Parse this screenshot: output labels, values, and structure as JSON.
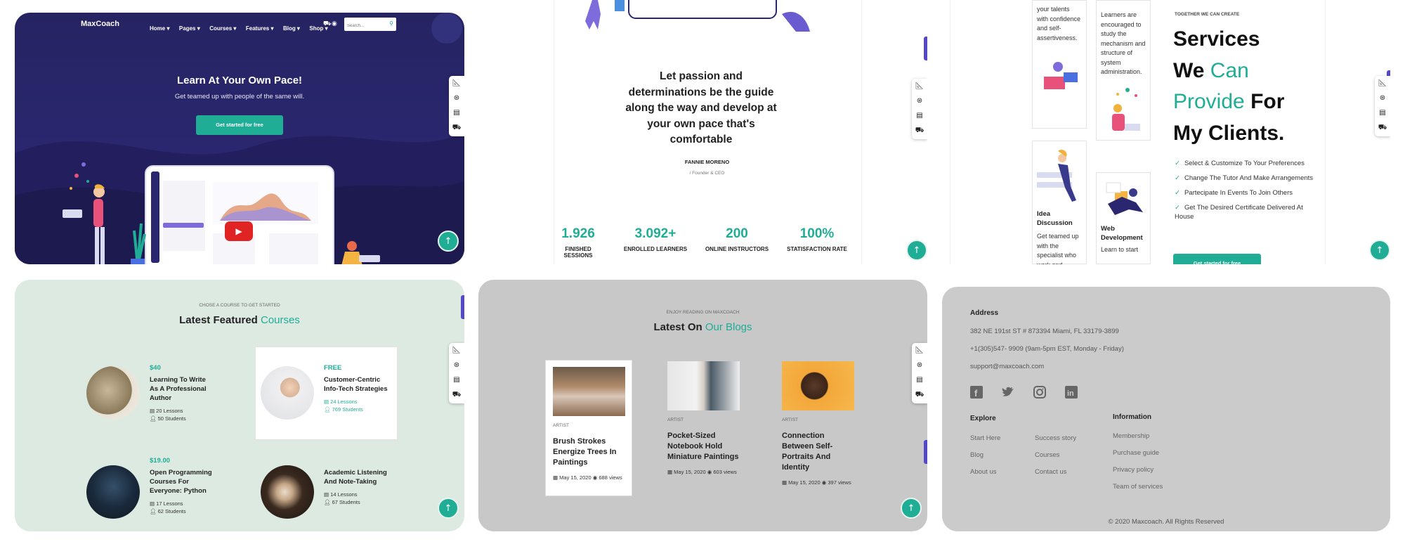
{
  "hero": {
    "logo": "MaxCoach",
    "nav": [
      "Home",
      "Pages",
      "Courses",
      "Features",
      "Blog",
      "Shop"
    ],
    "search_placeholder": "Search...",
    "title": "Learn At Your Own Pace!",
    "subtitle": "Get teamed up with people of the same will.",
    "cta": "Get started for free"
  },
  "testimonial": {
    "quote": "Let passion and determinations be the guide along the way and develop at your own pace that's comfortable",
    "name": "FANNIE MORENO",
    "role": "/ Founder & CEO",
    "stats": [
      {
        "value": "1.926",
        "label": "FINISHED SESSIONS"
      },
      {
        "value": "3.092+",
        "label": "ENROLLED LEARNERS"
      },
      {
        "value": "200",
        "label": "ONLINE INSTRUCTORS"
      },
      {
        "value": "100%",
        "label": "STATISFACTION RATE"
      }
    ]
  },
  "services": {
    "card_text_1": "your talents with confidence and self-assertiveness.",
    "card_text_2": "Learners are encouraged to study the mechanism and structure of system administration.",
    "card_title_3": "Idea Discussion",
    "card_text_3": "Get teamed up with the specialist who work and",
    "card_title_4": "Web Development",
    "card_text_4": "Learn to start",
    "eyebrow": "TOGETHER WE CAN CREATE",
    "heading_1": "Services",
    "heading_2a": "We ",
    "heading_2b": "Can",
    "heading_3a": "Provide ",
    "heading_3b": "For",
    "heading_4": "My Clients.",
    "checks": [
      "Select & Customize To Your Preferences",
      "Change The Tutor And Make Arrangements",
      "Partecipate In Events To Join Others",
      "Get The Desired Certificate Delivered At House"
    ],
    "cta": "Get started for free"
  },
  "courses": {
    "eyebrow": "CHOSE A COURSE TO GET STARTED",
    "title_a": "Latest Featured ",
    "title_b": "Courses",
    "items": [
      {
        "price": "$40",
        "title": "Learning To Write As A Professional Author",
        "lessons": "20 Lessons",
        "students": "50 Students"
      },
      {
        "price": "FREE",
        "title": "Customer-Centric Info-Tech Strategies",
        "lessons": "24 Lessons",
        "students": "769 Students"
      },
      {
        "price": "$19.00",
        "title": "Open Programming Courses For Everyone: Python",
        "lessons": "17 Lessons",
        "students": "62 Students"
      },
      {
        "price": "",
        "title": "Academic Listening And Note-Taking",
        "lessons": "14 Lessons",
        "students": "67 Students"
      }
    ]
  },
  "blogs": {
    "eyebrow": "ENJOY READING ON MAXCOACH",
    "title_a": "Latest On ",
    "title_b": "Our Blogs",
    "posts": [
      {
        "category": "ARTIST",
        "title": "Brush Strokes Energize Trees In Paintings",
        "date": "May 15, 2020",
        "views": "688 views"
      },
      {
        "category": "ARTIST",
        "title": "Pocket-Sized Notebook Hold Miniature Paintings",
        "date": "May 15, 2020",
        "views": "603 views"
      },
      {
        "category": "ARTIST",
        "title": "Connection Between Self-Portraits And Identity",
        "date": "May 15, 2020",
        "views": "397 views"
      }
    ]
  },
  "footer": {
    "address_title": "Address",
    "address": "382 NE 191st ST # 873394 Miami, FL 33179-3899",
    "phone": "+1(305)547- 9909 (9am-5pm EST, Monday - Friday)",
    "email": "support@maxcoach.com",
    "explore_title": "Explore",
    "explore_col1": [
      "Start Here",
      "Blog",
      "About us"
    ],
    "explore_col2": [
      "Success story",
      "Courses",
      "Contact us"
    ],
    "info_title": "Information",
    "info_links": [
      "Membership",
      "Purchase guide",
      "Privacy policy",
      "Team of services"
    ],
    "copyright": "© 2020 Maxcoach. All Rights Reserved"
  },
  "icons": [
    "ruler-icon",
    "lifebuoy-icon",
    "book-icon",
    "cart-icon",
    "arrow-up-icon",
    "search-icon",
    "play-icon",
    "facebook-icon",
    "twitter-icon",
    "instagram-icon",
    "linkedin-icon",
    "check-icon",
    "calendar-icon",
    "eye-icon",
    "user-icon",
    "file-icon"
  ],
  "colors": {
    "accent": "#20ad96",
    "hero_bg": "#262362",
    "courses_bg": "#ddeae2",
    "text_dark": "#222222"
  }
}
